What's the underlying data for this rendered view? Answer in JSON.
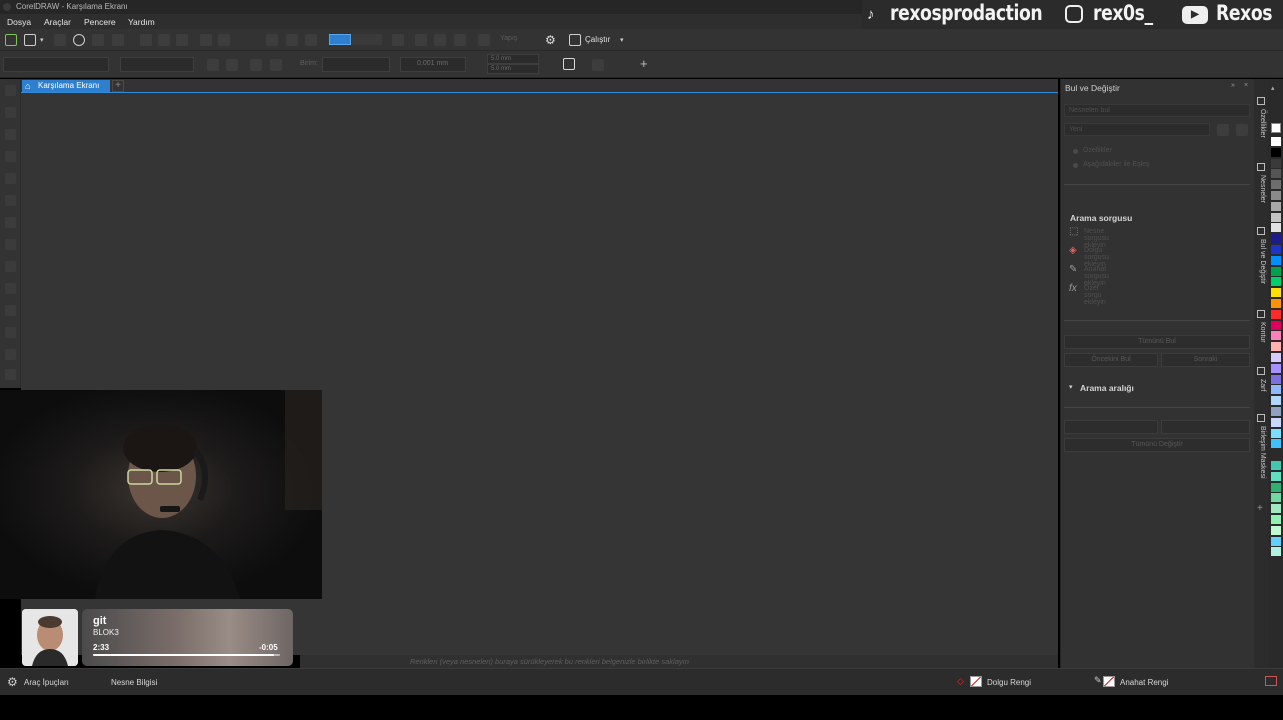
{
  "window": {
    "title": "CorelDRAW - Karşılama Ekranı"
  },
  "menu": [
    "Dosya",
    "Araçlar",
    "Pencere",
    "Yardım"
  ],
  "social": {
    "tiktok": "rexosprodaction",
    "instagram": "rex0s_",
    "youtube": "Rexos",
    "icons": [
      "tiktok-icon",
      "instagram-icon",
      "youtube-icon"
    ]
  },
  "toolbar": {
    "launch_label": "Çalıştır",
    "snap_label": "Yapış",
    "unit_label": "Birim:",
    "nudge_value": "0.001 mm",
    "dup_x": "5.0 mm",
    "dup_y": "5.0 mm",
    "accent_color": "#2f7fd0"
  },
  "tabs": {
    "home": "Karşılama Ekranı"
  },
  "hint": "Renkleri (veya nesneleri) buraya sürükleyerek bu renkleri belgenizle birlikte saklayın",
  "music": {
    "song": "git",
    "artist": "BLOK3",
    "elapsed": "2:33",
    "remaining": "-0:05",
    "progress": 0.97
  },
  "docker": {
    "title": "Bul ve Değiştir",
    "dropdown1": "Nesneleri bul",
    "dropdown2": "Yeni",
    "option1": "Özellikler",
    "option2": "Aşağıdakiler ile Eşleş",
    "query_heading": "Arama sorgusu",
    "query_items": [
      "Nesne sorgusu ekleyin",
      "Dolgu sorgusu ekleyin",
      "Anahat sorgusu ekleyin",
      "Özel sorgu ekleyin"
    ],
    "find_all": "Tümünü Bul",
    "prev": "Öncekini Bul",
    "next": "Sonraki",
    "range_heading": "Arama aralığı",
    "replace_all": "Tümünü Değiştir"
  },
  "docker_tabs": [
    "Özellikler",
    "Nesneler",
    "Bul ve Değiştir",
    "Kontur",
    "Zarf",
    "Birleşim Maskesi"
  ],
  "status": {
    "tips": "Araç İpuçları",
    "object_info": "Nesne Bilgisi",
    "fill": "Dolgu Rengi",
    "outline": "Anahat Rengi"
  },
  "palette": [
    "#ffffff",
    "#000000",
    "#3a3a3a",
    "#555555",
    "#6e6e6e",
    "#8a8a8a",
    "#a8a8a8",
    "#c4c4c4",
    "#e2e2e2",
    "#1c1c8c",
    "#1f35c8",
    "#0090ff",
    "#00a34c",
    "#00d06a",
    "#ffe000",
    "#ff9000",
    "#ff2a2a",
    "#e0005c",
    "#ff80b8",
    "#ffb0b0",
    "#d8c8ff",
    "#a890ff",
    "#7c70e0",
    "#8fb8ff",
    "#b0d8ff",
    "#90a0c0",
    "#c8d8ff",
    "#7ae0ff",
    "#3fc0ff",
    "#2a2a2a",
    "#40c8b0",
    "#60e0c0",
    "#30b070",
    "#70d8a0",
    "#a0e8c0",
    "#90f0b0",
    "#c0f8d0",
    "#60d0ff",
    "#b0f0e0"
  ]
}
